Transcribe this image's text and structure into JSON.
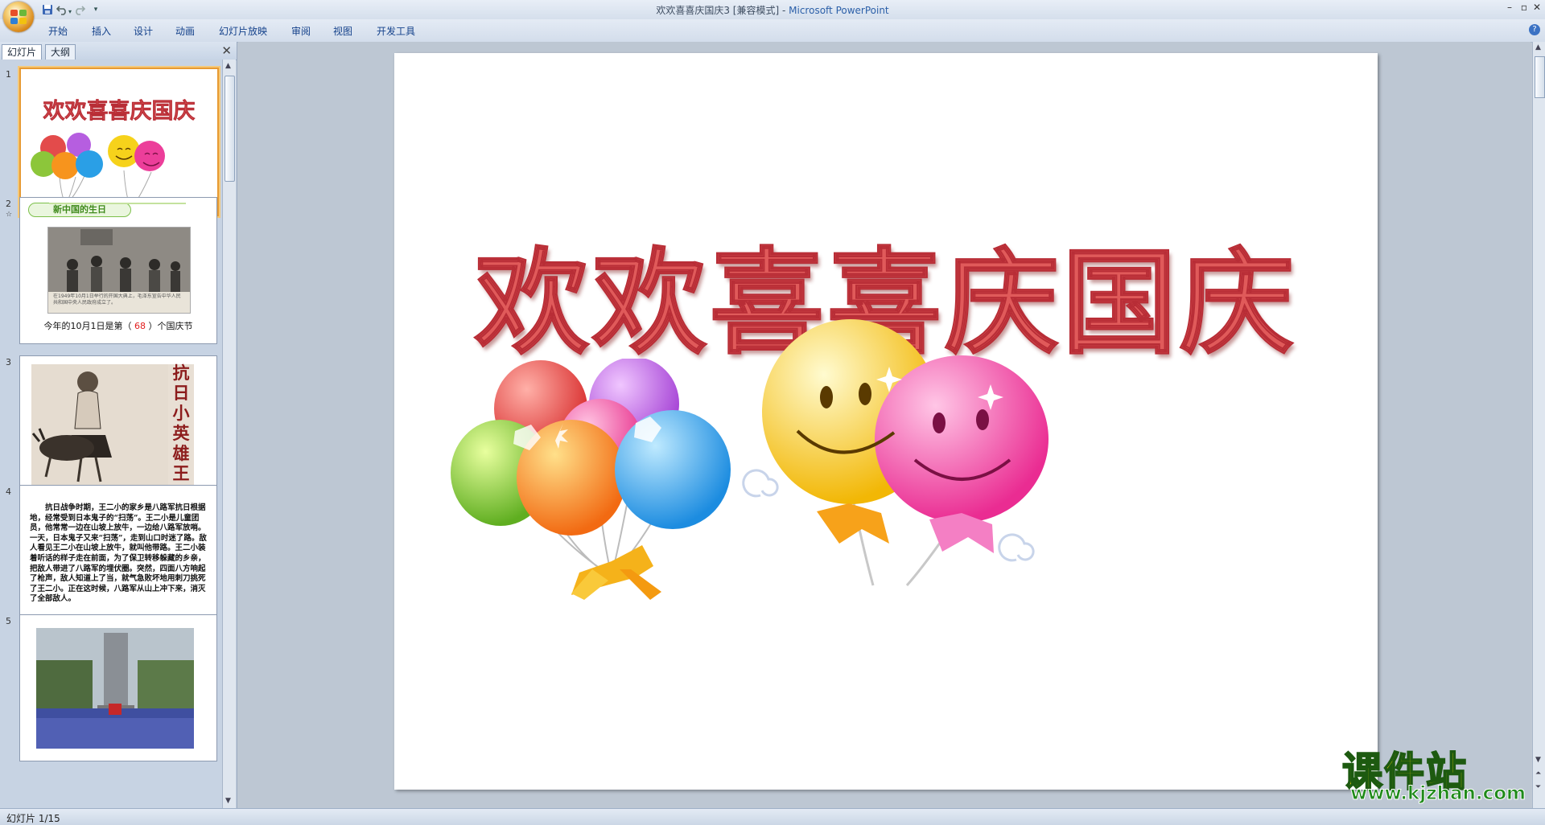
{
  "window": {
    "title_doc": "欢欢喜喜庆国庆3 [兼容模式] - ",
    "title_app": "Microsoft PowerPoint",
    "min_glyph": "–",
    "max_glyph": "▫",
    "close_glyph": "✕"
  },
  "quick_access": {
    "save_icon": "save-icon",
    "undo_icon": "undo-icon",
    "redo_icon": "redo-icon",
    "customize_glyph": "▾"
  },
  "ribbon": {
    "tabs": [
      "开始",
      "插入",
      "设计",
      "动画",
      "幻灯片放映",
      "审阅",
      "视图",
      "开发工具"
    ],
    "help_glyph": "?"
  },
  "panel": {
    "tab_slides": "幻灯片",
    "tab_outline": "大纲",
    "close_glyph": "✕"
  },
  "thumbnails": [
    {
      "number": "1",
      "title": "欢欢喜喜庆国庆"
    },
    {
      "number": "2",
      "banner": "新中国的生日",
      "photo_caption": "在1949年10月1日举行的开国大典上，毛泽东宣告中华人民共和国中央人民政府成立了。",
      "caption_before": "今年的10月1日是第（",
      "caption_answer": " 68 ",
      "caption_after": "）个国庆节"
    },
    {
      "number": "3",
      "vertical_text": "抗日小英雄王二小"
    },
    {
      "number": "4",
      "paragraph": "抗日战争时期，王二小的家乡是八路军抗日根据地，经常受到日本鬼子的“扫荡”。王二小是儿童团员，他常常一边在山坡上放牛，一边给八路军放哨。一天，日本鬼子又来“扫荡”，走到山口时迷了路。敌人看见王二小在山坡上放牛，就叫他带路。王二小装着听话的样子走在前面，为了保卫转移躲藏的乡亲，把敌人带进了八路军的埋伏圈。突然，四面八方响起了枪声，敌人知道上了当，就气急败坏地用刺刀挑死了王二小。正在这时候，八路军从山上冲下来，消灭了全部敌人。"
    },
    {
      "number": "5"
    }
  ],
  "slide": {
    "title": "欢欢喜喜庆国庆"
  },
  "status": {
    "text": "幻灯片 1/15"
  },
  "watermark": {
    "title": "课件站",
    "url": "www.kjzhan.com"
  },
  "colors": {
    "title_red": "#e05a5a",
    "selection_orange": "#e79a32",
    "watermark_yellow": "#ffe200",
    "watermark_green": "#1f8a1a"
  }
}
